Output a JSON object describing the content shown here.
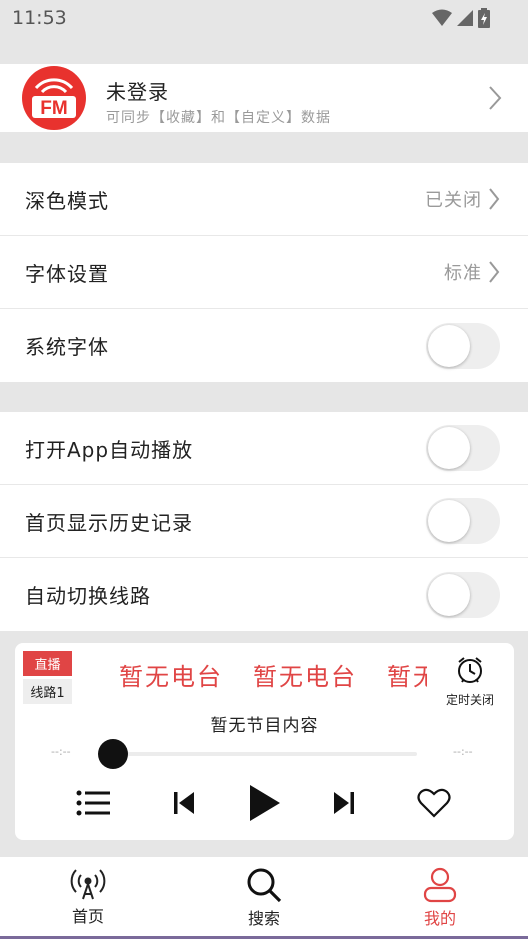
{
  "status_bar": {
    "time": "11:53"
  },
  "account": {
    "title": "未登录",
    "subtitle": "可同步【收藏】和【自定义】数据",
    "logo_text": "FM"
  },
  "display_settings": [
    {
      "label": "深色模式",
      "value": "已关闭",
      "type": "link"
    },
    {
      "label": "字体设置",
      "value": "标准",
      "type": "link"
    },
    {
      "label": "系统字体",
      "type": "toggle",
      "on": false
    }
  ],
  "playback_settings": [
    {
      "label": "打开App自动播放",
      "type": "toggle",
      "on": false
    },
    {
      "label": "首页显示历史记录",
      "type": "toggle",
      "on": false
    },
    {
      "label": "自动切换线路",
      "type": "toggle",
      "on": false
    }
  ],
  "player": {
    "live_badge": "直播",
    "line_badge": "线路1",
    "station_marquee": "暂无电台",
    "timer_label": "定时关闭",
    "program": "暂无节目内容",
    "time_elapsed": "--:--",
    "time_total": "--:--",
    "progress": 0
  },
  "tabs": [
    {
      "label": "首页",
      "icon": "radio-icon",
      "active": false
    },
    {
      "label": "搜索",
      "icon": "search-icon",
      "active": false
    },
    {
      "label": "我的",
      "icon": "user-icon",
      "active": true
    }
  ],
  "colors": {
    "accent": "#e04545",
    "text": "#222222",
    "secondary_text": "#9a9a9a",
    "background": "#e6e6e6"
  }
}
